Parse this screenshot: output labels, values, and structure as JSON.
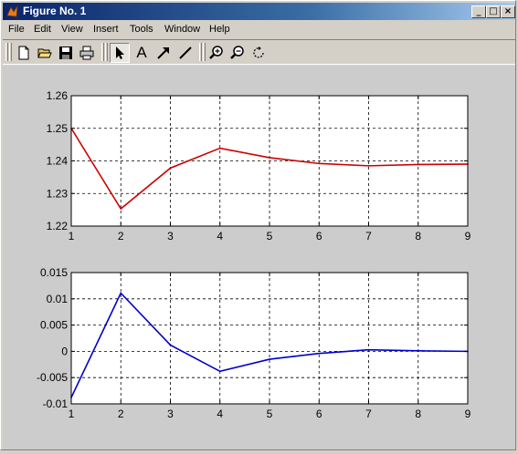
{
  "window": {
    "title": "Figure No. 1",
    "controls": {
      "minimize": "_",
      "maximize": "□",
      "close": "×"
    }
  },
  "menubar": {
    "items": [
      "File",
      "Edit",
      "View",
      "Insert",
      "Tools",
      "Window",
      "Help"
    ]
  },
  "toolbar": {
    "buttons": [
      "new-file-icon",
      "open-folder-icon",
      "save-icon",
      "print-icon",
      "select-arrow-icon",
      "insert-text-icon",
      "insert-arrow-icon",
      "insert-line-icon",
      "zoom-in-icon",
      "zoom-out-icon",
      "rotate-icon"
    ],
    "text_tool_label": "A"
  },
  "colors": {
    "figure_background": "#cccccc",
    "series_top": "#cc0000",
    "series_bottom": "#0000cc"
  },
  "chart_data": [
    {
      "type": "line",
      "x": [
        1,
        2,
        3,
        4,
        5,
        6,
        7,
        8,
        9
      ],
      "xlim": [
        1,
        9
      ],
      "ylim": [
        1.22,
        1.26
      ],
      "xticks": [
        "1",
        "2",
        "3",
        "4",
        "5",
        "6",
        "7",
        "8",
        "9"
      ],
      "yticks": [
        "1.22",
        "1.23",
        "1.24",
        "1.25",
        "1.26"
      ],
      "grid": true,
      "series": [
        {
          "values": [
            1.25,
            1.2253,
            1.2378,
            1.2439,
            1.241,
            1.2392,
            1.2385,
            1.2389,
            1.239
          ],
          "color": "#cc0000"
        }
      ]
    },
    {
      "type": "line",
      "x": [
        1,
        2,
        3,
        4,
        5,
        6,
        7,
        8,
        9
      ],
      "xlim": [
        1,
        9
      ],
      "ylim": [
        -0.01,
        0.015
      ],
      "xticks": [
        "1",
        "2",
        "3",
        "4",
        "5",
        "6",
        "7",
        "8",
        "9"
      ],
      "yticks": [
        "-0.01",
        "-0.005",
        "0",
        "0.005",
        "0.01",
        "0.015"
      ],
      "grid": true,
      "series": [
        {
          "values": [
            -0.0088,
            0.0111,
            0.0012,
            -0.0038,
            -0.0015,
            -0.0004,
            0.0003,
            0.0001,
            0.0
          ],
          "color": "#0000cc"
        }
      ]
    }
  ]
}
